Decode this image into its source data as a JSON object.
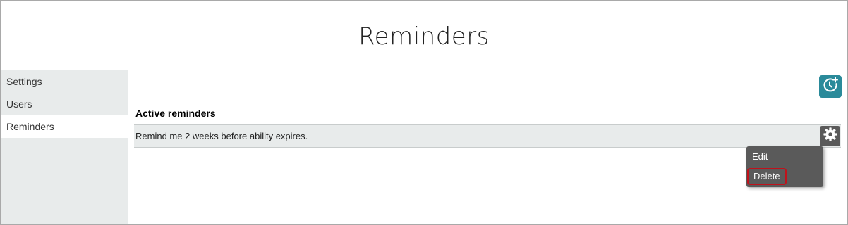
{
  "header": {
    "title": "Reminders"
  },
  "sidebar": {
    "items": [
      {
        "label": "Settings"
      },
      {
        "label": "Users"
      },
      {
        "label": "Reminders",
        "active": true
      }
    ]
  },
  "content": {
    "add_button": {
      "icon": "clock-plus-icon"
    },
    "section_heading": "Active reminders",
    "reminders": [
      {
        "text": "Remind me 2 weeks before ability expires."
      }
    ],
    "gear_button": {
      "icon": "gear-icon"
    },
    "menu": {
      "items": [
        {
          "label": "Edit"
        },
        {
          "label": "Delete",
          "highlighted": true
        }
      ]
    }
  },
  "colors": {
    "accent": "#2a8a9a",
    "sidebar_bg": "#e8ebeb",
    "menu_bg": "#5a5a5a",
    "highlight_border": "#c0121b"
  }
}
